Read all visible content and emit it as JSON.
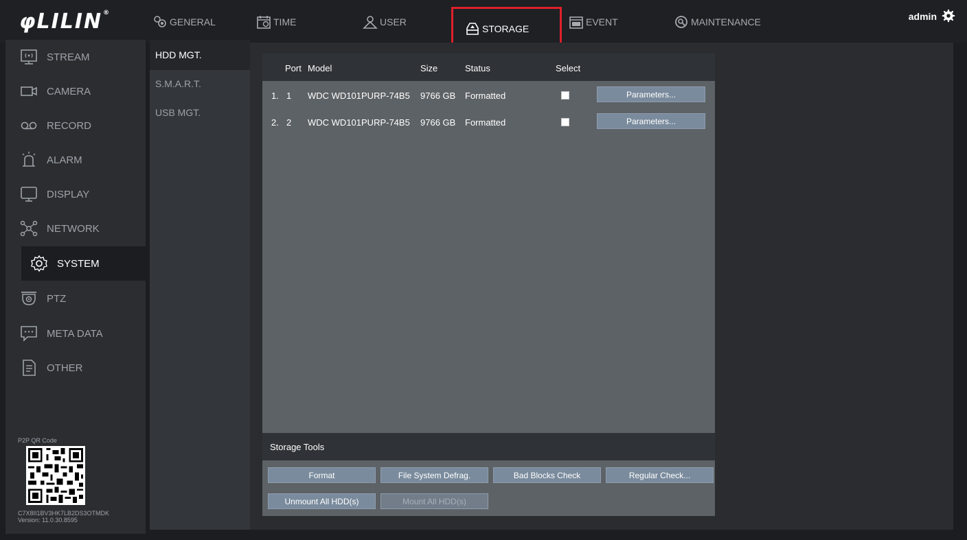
{
  "app": {
    "logo": "LILIN",
    "user": "admin"
  },
  "tabs": [
    {
      "label": "GENERAL",
      "icon": "general-icon"
    },
    {
      "label": "TIME",
      "icon": "calendar-clock-icon"
    },
    {
      "label": "USER",
      "icon": "user-icon"
    },
    {
      "label": "STORAGE",
      "icon": "storage-icon",
      "active": true
    },
    {
      "label": "EVENT",
      "icon": "event-icon"
    },
    {
      "label": "MAINTENANCE",
      "icon": "maintenance-icon"
    }
  ],
  "sidebar": {
    "items": [
      {
        "label": "STREAM",
        "icon": "stream-icon"
      },
      {
        "label": "CAMERA",
        "icon": "camera-icon"
      },
      {
        "label": "RECORD",
        "icon": "record-icon"
      },
      {
        "label": "ALARM",
        "icon": "alarm-icon"
      },
      {
        "label": "DISPLAY",
        "icon": "display-icon"
      },
      {
        "label": "NETWORK",
        "icon": "network-icon"
      },
      {
        "label": "SYSTEM",
        "icon": "system-gear-icon",
        "active": true
      },
      {
        "label": "PTZ",
        "icon": "ptz-camera-icon"
      },
      {
        "label": "META DATA",
        "icon": "metadata-icon"
      },
      {
        "label": "OTHER",
        "icon": "document-icon"
      }
    ],
    "qr_label": "P2P QR Code",
    "qr_code": "C7X8II1BV3HK7LB2DS3OTMDK",
    "version": "Version: 11.0.30.8595"
  },
  "submenu": {
    "items": [
      {
        "label": "HDD MGT.",
        "active": true
      },
      {
        "label": "S.M.A.R.T."
      },
      {
        "label": "USB MGT."
      }
    ]
  },
  "hdd_table": {
    "headers": {
      "port": "Port",
      "model": "Model",
      "size": "Size",
      "status": "Status",
      "select": "Select"
    },
    "rows": [
      {
        "index": "1.",
        "port": "1",
        "model": "WDC WD101PURP-74B5",
        "size": "9766 GB",
        "status": "Formatted",
        "selected": false,
        "button": "Parameters..."
      },
      {
        "index": "2.",
        "port": "2",
        "model": "WDC WD101PURP-74B5",
        "size": "9766 GB",
        "status": "Formatted",
        "selected": false,
        "button": "Parameters..."
      }
    ]
  },
  "storage_tools": {
    "title": "Storage Tools",
    "buttons": {
      "format": "Format",
      "defrag": "File System Defrag.",
      "bad_blocks": "Bad Blocks Check",
      "regular_check": "Regular Check...",
      "unmount": "Unmount All HDD(s)",
      "mount": "Mount All HDD(s)"
    }
  }
}
